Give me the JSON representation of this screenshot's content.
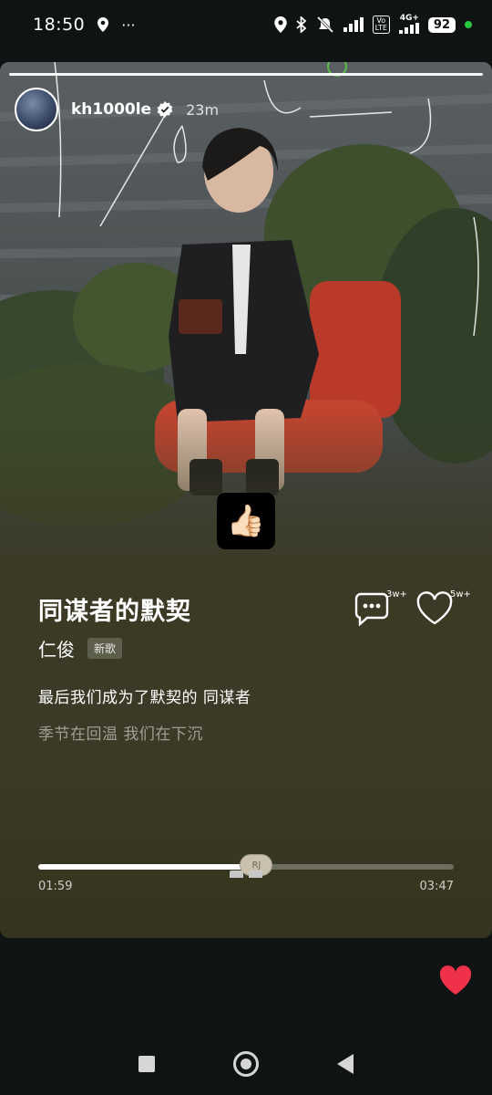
{
  "status_bar": {
    "time": "18:50",
    "more": "···",
    "volte": "Vo\nLTE",
    "network": "4G+",
    "battery": "92"
  },
  "story": {
    "username": "kh1000le",
    "age": "23m",
    "sticker_emoji": "👍🏻"
  },
  "song": {
    "title": "同谋者的默契",
    "artist": "仁俊",
    "tag": "新歌",
    "lyric_current": "最后我们成为了默契的 同谋者",
    "lyric_next": "季节在回温 我们在下沉",
    "comment_count": "3w+",
    "like_count": "5w+",
    "knob_label": "RJ",
    "elapsed": "01:59",
    "total": "03:47",
    "progress": 0.525
  },
  "colors": {
    "accent_like": "#f0314a",
    "online_dot": "#27c93f"
  }
}
